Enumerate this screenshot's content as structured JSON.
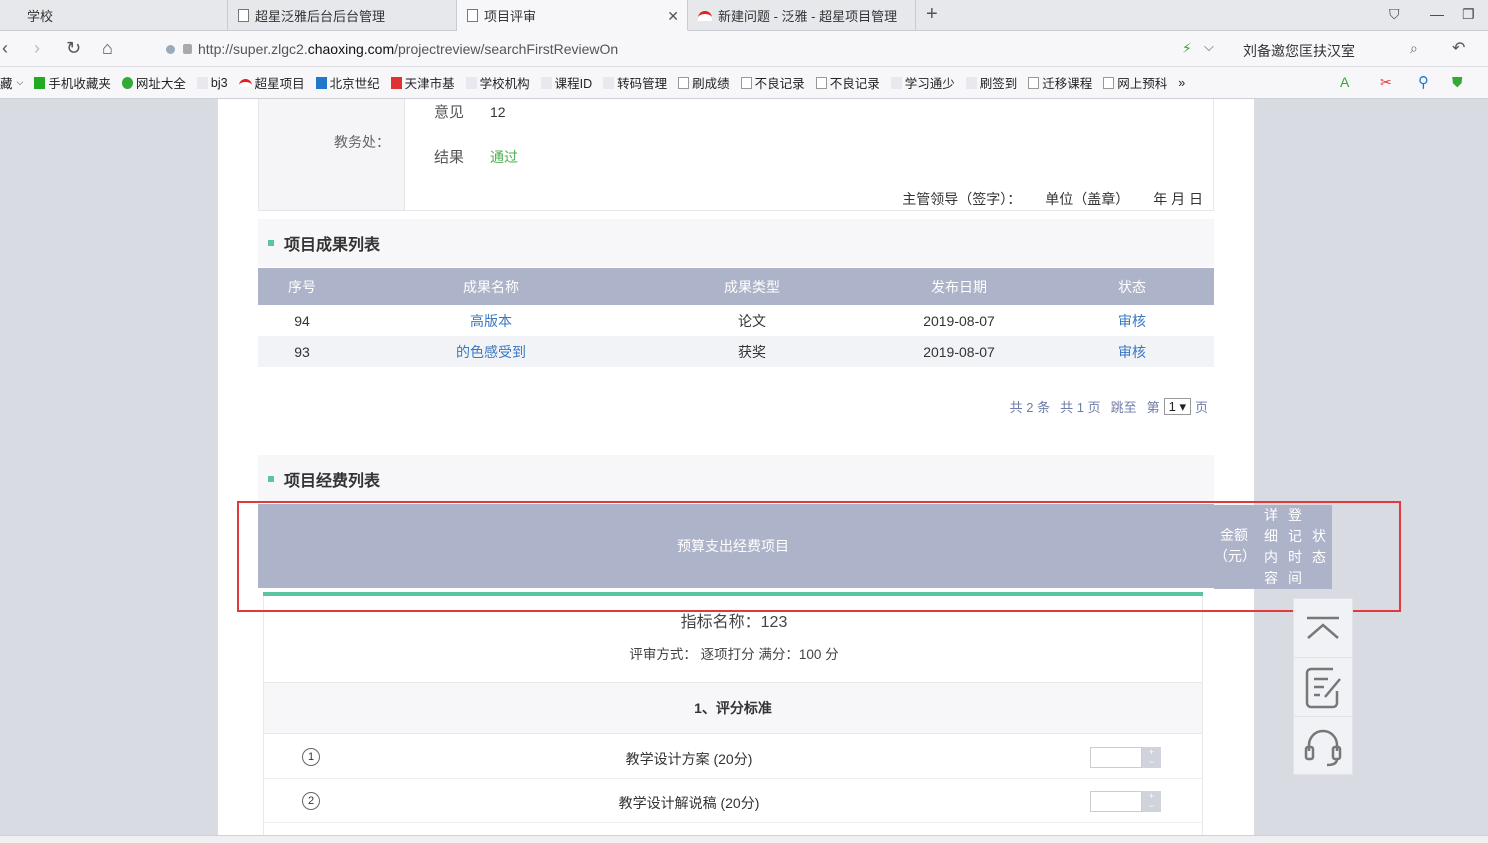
{
  "browser": {
    "tabs": [
      {
        "label": "学校"
      },
      {
        "label": "超星泛雅后台后台管理"
      },
      {
        "label": "项目评审"
      },
      {
        "label": "新建问题 - 泛雅 - 超星项目管理"
      }
    ],
    "url_prefix": "http://super.zlgc2.",
    "url_domain": "chaoxing.com",
    "url_path": "/projectreview/searchFirstReviewOn",
    "search_text": "刘备邀您匡扶汉室",
    "bookmarks": [
      "藏",
      "手机收藏夹",
      "网址大全",
      "bj3",
      "超星项目",
      "北京世纪",
      "天津市基",
      "学校机构",
      "课程ID",
      "转码管理",
      "刷成绩",
      "不良记录",
      "不良记录",
      "学习通少",
      "刷签到",
      "迁移课程",
      "网上预科",
      "»"
    ]
  },
  "review": {
    "dept_label": "教务处：",
    "opinion_label": "意见",
    "opinion_value": "12",
    "result_label": "结果",
    "result_value": "通过",
    "sign_leader": "主管领导（签字）：",
    "sign_unit": "单位（盖章）",
    "sign_date": "年 月 日"
  },
  "results": {
    "title": "项目成果列表",
    "columns": [
      "序号",
      "成果名称",
      "成果类型",
      "发布日期",
      "状态"
    ],
    "rows": [
      {
        "id": "94",
        "name": "高版本",
        "type": "论文",
        "date": "2019-08-07",
        "status": "审核"
      },
      {
        "id": "93",
        "name": "的色感受到",
        "type": "获奖",
        "date": "2019-08-07",
        "status": "审核"
      }
    ],
    "pager": {
      "total": "共 2 条",
      "pages": "共 1 页",
      "jump": "跳至",
      "prefix": "第",
      "page": "1 ▾",
      "suffix": "页"
    }
  },
  "budget": {
    "title": "项目经费列表",
    "col_item": "预算支出经费项目",
    "col_amount": "金额（元）",
    "col_detail": "详细内容",
    "col_time": "登记时间",
    "col_status": "状态"
  },
  "indicator": {
    "name": "指标名称：123",
    "mode": "评审方式： 逐项打分 满分：100 分",
    "criteria_title": "1、评分标准",
    "criteria": [
      {
        "num": "1",
        "label": "教学设计方案 (20分)"
      },
      {
        "num": "2",
        "label": "教学设计解说稿 (20分)"
      }
    ]
  },
  "colors": {
    "header": "#adb3c8",
    "accent": "#5cc4a0",
    "link": "#3a78c3",
    "highlight": "#e03a3a"
  }
}
